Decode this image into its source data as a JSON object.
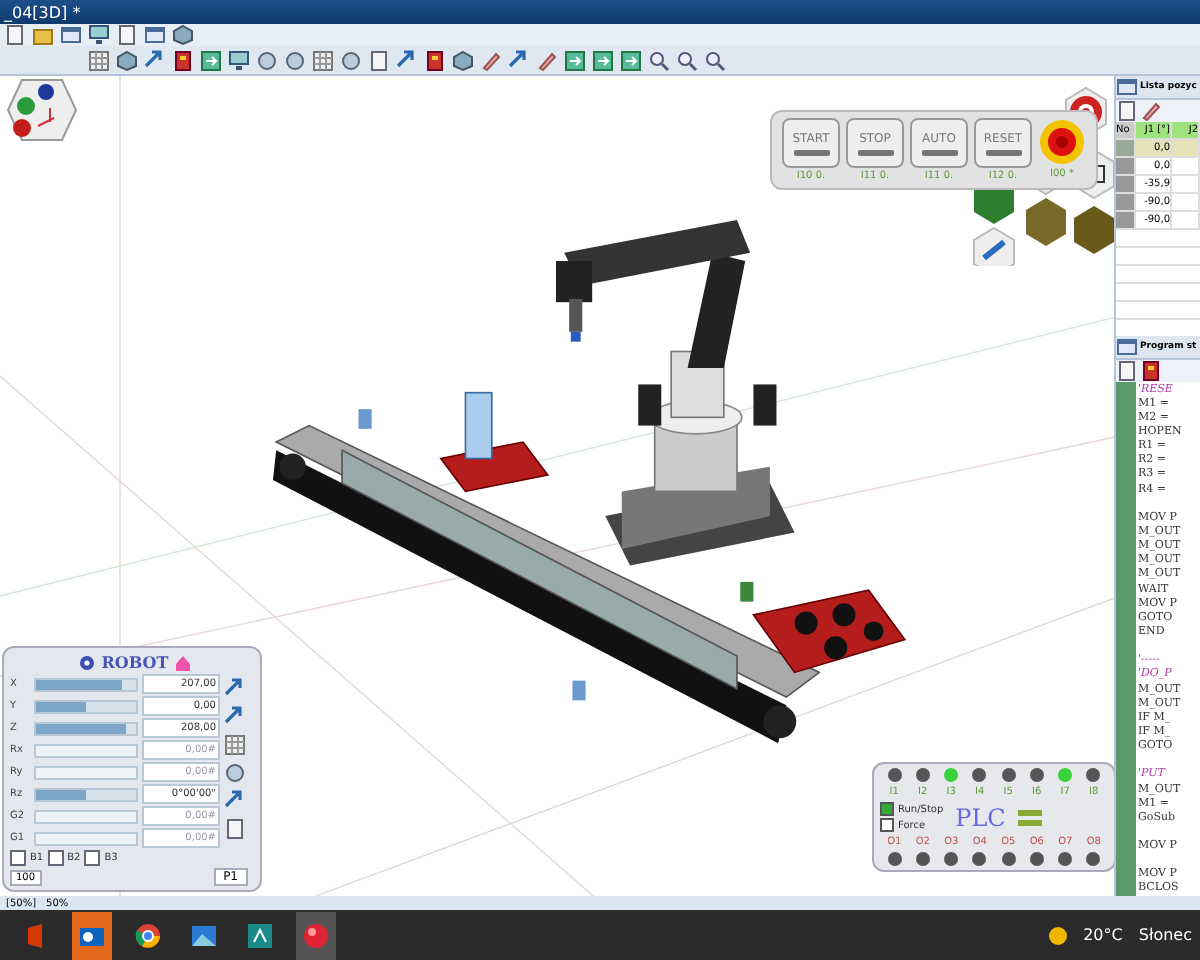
{
  "window": {
    "title": "_04[3D] *"
  },
  "control_panel": {
    "buttons": [
      {
        "label": "START",
        "code": "I10 0."
      },
      {
        "label": "STOP",
        "code": "I11 0."
      },
      {
        "label": "AUTO",
        "code": "I11 0."
      },
      {
        "label": "RESET",
        "code": "I12 0."
      }
    ],
    "estop_code": "I00 *"
  },
  "position_list": {
    "title": "Lista pozyc",
    "columns": [
      "No",
      "J1 [°]",
      "J2"
    ],
    "rows": [
      {
        "value": "0,0",
        "selected": true
      },
      {
        "value": "0,0",
        "selected": false
      },
      {
        "value": "-35,9",
        "selected": false
      },
      {
        "value": "-90,0",
        "selected": false
      },
      {
        "value": "-90,0",
        "selected": false
      }
    ]
  },
  "program": {
    "title": "Program st",
    "lines": [
      {
        "kind": "comment",
        "text": "'RESE"
      },
      {
        "kind": "code",
        "text": "M1 = "
      },
      {
        "kind": "code",
        "text": "M2 = "
      },
      {
        "kind": "code",
        "text": "HOPEN"
      },
      {
        "kind": "code",
        "text": "R1 = "
      },
      {
        "kind": "code",
        "text": "R2 = "
      },
      {
        "kind": "code",
        "text": "R3 = "
      },
      {
        "kind": "code",
        "text": "R4 = "
      },
      {
        "kind": "blank"
      },
      {
        "kind": "code",
        "text": "MOV P"
      },
      {
        "kind": "code",
        "text": "M_OUT"
      },
      {
        "kind": "code",
        "text": "M_OUT"
      },
      {
        "kind": "code",
        "text": "M_OUT"
      },
      {
        "kind": "code",
        "text": "M_OUT"
      },
      {
        "kind": "code",
        "text": "WAIT "
      },
      {
        "kind": "code",
        "text": "MOV P"
      },
      {
        "kind": "code",
        "text": "GOTO "
      },
      {
        "kind": "code",
        "text": "END"
      },
      {
        "kind": "blank"
      },
      {
        "kind": "comment",
        "text": "'-----"
      },
      {
        "kind": "comment",
        "text": "'DO_P"
      },
      {
        "kind": "code",
        "text": "M_OUT"
      },
      {
        "kind": "code",
        "text": "M_OUT"
      },
      {
        "kind": "code",
        "text": "IF M_"
      },
      {
        "kind": "code",
        "text": "IF M_"
      },
      {
        "kind": "code",
        "text": "GOTO"
      },
      {
        "kind": "blank"
      },
      {
        "kind": "comment",
        "text": "'PUT"
      },
      {
        "kind": "code",
        "text": "M_OUT"
      },
      {
        "kind": "code",
        "text": "M1 = "
      },
      {
        "kind": "code",
        "text": "GoSub"
      },
      {
        "kind": "blank"
      },
      {
        "kind": "code",
        "text": "MOV P"
      },
      {
        "kind": "blank"
      },
      {
        "kind": "code",
        "text": "MOV P"
      },
      {
        "kind": "code",
        "text": "BCLOS"
      }
    ]
  },
  "robot_panel": {
    "title": "ROBOT",
    "axes": [
      {
        "label": "X",
        "value": "207,00",
        "enabled": true,
        "level": 0.85
      },
      {
        "label": "Y",
        "value": "0,00",
        "enabled": true,
        "level": 0.5
      },
      {
        "label": "Z",
        "value": "208,00",
        "enabled": true,
        "level": 0.9
      },
      {
        "label": "Rx",
        "value": "0,00#",
        "enabled": false
      },
      {
        "label": "Ry",
        "value": "0,00#",
        "enabled": false
      },
      {
        "label": "Rz",
        "value": "0°00'00\"",
        "enabled": true,
        "level": 0.5
      },
      {
        "label": "G2",
        "value": "0,00#",
        "enabled": false
      },
      {
        "label": "G1",
        "value": "0,00#",
        "enabled": false
      }
    ],
    "checkboxes": [
      {
        "label": "B1",
        "checked": false
      },
      {
        "label": "B2",
        "checked": false
      },
      {
        "label": "B3",
        "checked": false
      }
    ],
    "position": "P1",
    "speed": "100"
  },
  "plc": {
    "title": "PLC",
    "inputs": [
      {
        "label": "I1",
        "on": false
      },
      {
        "label": "I2",
        "on": false
      },
      {
        "label": "I3",
        "on": true
      },
      {
        "label": "I4",
        "on": false
      },
      {
        "label": "I5",
        "on": false
      },
      {
        "label": "I6",
        "on": false
      },
      {
        "label": "I7",
        "on": true
      },
      {
        "label": "I8",
        "on": false
      }
    ],
    "outputs": [
      {
        "label": "O1",
        "on": false
      },
      {
        "label": "O2",
        "on": false
      },
      {
        "label": "O3",
        "on": false
      },
      {
        "label": "O4",
        "on": false
      },
      {
        "label": "O5",
        "on": false
      },
      {
        "label": "O6",
        "on": false
      },
      {
        "label": "O7",
        "on": false
      },
      {
        "label": "O8",
        "on": false
      }
    ],
    "options": [
      {
        "label": "Run/Stop",
        "checked": true
      },
      {
        "label": "Force",
        "checked": false
      }
    ]
  },
  "status_bar": {
    "zoom_box": "[50%]",
    "zoom": "50%"
  },
  "taskbar": {
    "weather": "20°C",
    "weather_text": "Słonec"
  }
}
